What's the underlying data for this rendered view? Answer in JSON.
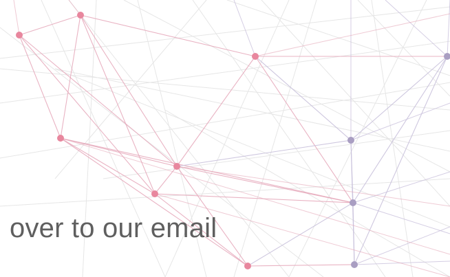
{
  "caption": {
    "text": "over to our email"
  },
  "colors": {
    "background": "#ffffff",
    "text": "#5f5f5f",
    "pink_node": "#e8879e",
    "pink_line": "#e5a6b8",
    "purple_node": "#a99ec2",
    "purple_line": "#c9c1dc",
    "gray_line": "#e6e6e6"
  }
}
